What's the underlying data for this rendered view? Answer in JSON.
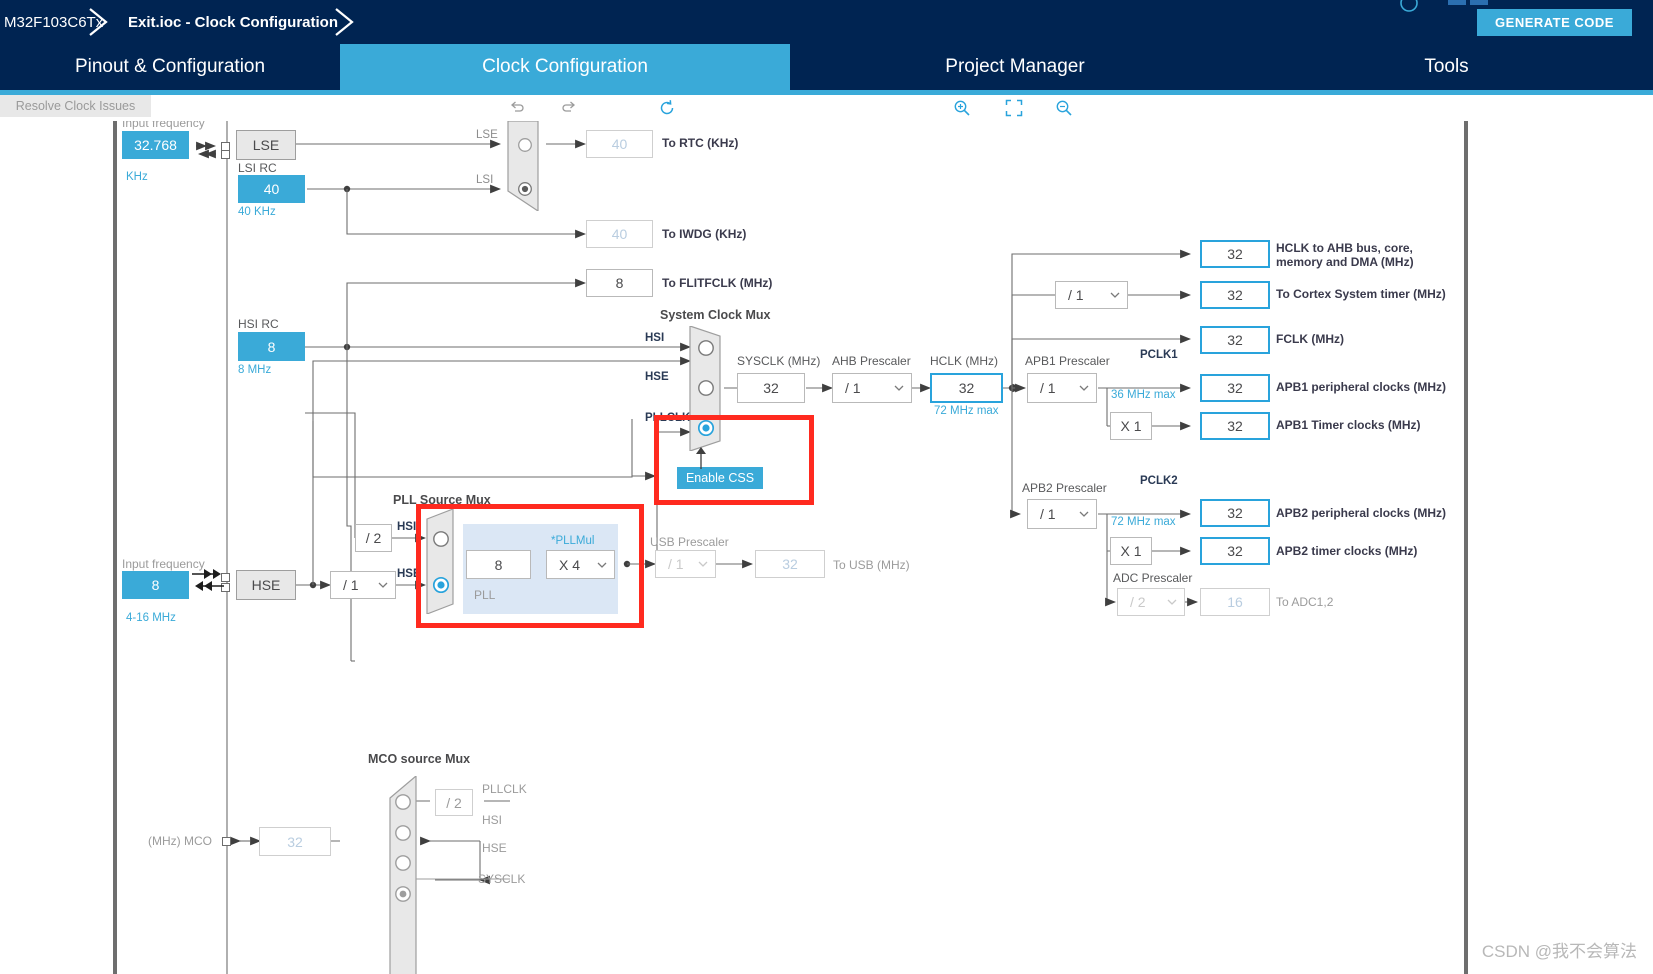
{
  "window": {
    "breadcrumbs": [
      {
        "label": "M32F103C6Tx",
        "bold": false
      },
      {
        "label": "Exit.ioc - Clock Configuration",
        "bold": true
      }
    ],
    "generate_code_label": "GENERATE CODE"
  },
  "tabs": [
    {
      "label": "Pinout & Configuration",
      "active": false
    },
    {
      "label": "Clock Configuration",
      "active": true
    },
    {
      "label": "Project Manager",
      "active": false
    },
    {
      "label": "Tools",
      "active": false
    }
  ],
  "toolbar": {
    "undo": "undo-icon",
    "redo": "redo-icon",
    "refresh": "refresh-icon",
    "resolve_label": "Resolve Clock Issues",
    "zoom_in": "zoom-in-icon",
    "zoom_fit": "zoom-fit-icon",
    "zoom_out": "zoom-out-icon"
  },
  "colors": {
    "navy": "#002452",
    "accent": "#3aaad8",
    "highlight_red": "#ff2a1f",
    "source_blue": "#3aaad8",
    "pll_group": "#dbe7f5"
  },
  "diagram": {
    "lse": {
      "input_frequency_label": "Input frequency",
      "value": "32.768",
      "unit_label": "KHz",
      "osc_label": "LSE"
    },
    "lsi": {
      "title": "LSI RC",
      "value": "40",
      "sub": "40 KHz"
    },
    "hsi": {
      "title": "HSI RC",
      "value": "8",
      "sub": "8 MHz"
    },
    "hse": {
      "input_frequency_label": "Input frequency",
      "value": "8",
      "range_label": "4-16 MHz",
      "osc_label": "HSE"
    },
    "rtc_mux": {
      "input_1": "LSE",
      "input_2": "LSI",
      "selected_index": 1
    },
    "outputs_left": [
      {
        "value": "40",
        "label": "To RTC (KHz)",
        "disabled": true
      },
      {
        "value": "40",
        "label": "To IWDG (KHz)",
        "disabled": true
      },
      {
        "value": "8",
        "label": "To FLITFCLK (MHz)",
        "disabled": false
      }
    ],
    "system_clock_mux": {
      "title": "System Clock Mux",
      "inputs": [
        "HSI",
        "HSE",
        "PLLCLK"
      ],
      "selected_index": 2
    },
    "css": {
      "label": "Enable CSS"
    },
    "sysclk": {
      "title": "SYSCLK (MHz)",
      "value": "32"
    },
    "ahb_prescaler": {
      "title": "AHB Prescaler",
      "value": "/ 1"
    },
    "hclk": {
      "title": "HCLK (MHz)",
      "value": "32",
      "max": "72 MHz max"
    },
    "pll_source_mux": {
      "title": "PLL Source Mux",
      "inputs": [
        "HSI",
        "HSE"
      ],
      "selected_index": 1,
      "hsi_divider": "/ 2",
      "hse_divider": "/ 1"
    },
    "pll": {
      "group_label": "PLL",
      "input_value": "8",
      "mul_label": "*PLLMul",
      "mul_value": "X 4"
    },
    "usb_prescaler": {
      "title": "USB Prescaler",
      "value": "/ 1",
      "out_value": "32",
      "out_label": "To USB (MHz)"
    },
    "cortex_prescaler": {
      "value": "/ 1"
    },
    "outputs_right": [
      {
        "value": "32",
        "label": "HCLK to AHB bus, core,\nmemory and DMA (MHz)"
      },
      {
        "value": "32",
        "label": "To Cortex System timer (MHz)"
      },
      {
        "value": "32",
        "label": "FCLK (MHz)"
      },
      {
        "value": "32",
        "label": "APB1 peripheral clocks (MHz)"
      },
      {
        "value": "32",
        "label": "APB1 Timer clocks (MHz)"
      },
      {
        "value": "32",
        "label": "APB2 peripheral clocks (MHz)"
      },
      {
        "value": "32",
        "label": "APB2 timer clocks (MHz)"
      }
    ],
    "apb1": {
      "prescaler_title": "APB1 Prescaler",
      "prescaler_value": "/ 1",
      "pclk_label": "PCLK1",
      "max": "36 MHz max",
      "timer_mul": "X 1"
    },
    "apb2": {
      "prescaler_title": "APB2 Prescaler",
      "prescaler_value": "/ 1",
      "pclk_label": "PCLK2",
      "max": "72 MHz max",
      "timer_mul": "X 1"
    },
    "adc": {
      "prescaler_title": "ADC Prescaler",
      "prescaler_value": "/ 2",
      "out_value": "16",
      "out_label": "To ADC1,2"
    },
    "mco": {
      "title": "MCO source Mux",
      "inputs": [
        "PLLCLK",
        "HSI",
        "HSE",
        "SYSCLK"
      ],
      "selected_index": 3,
      "pll_divider": "/ 2",
      "out_value": "32",
      "out_label": "(MHz) MCO"
    }
  },
  "watermark": "CSDN @我不会算法"
}
